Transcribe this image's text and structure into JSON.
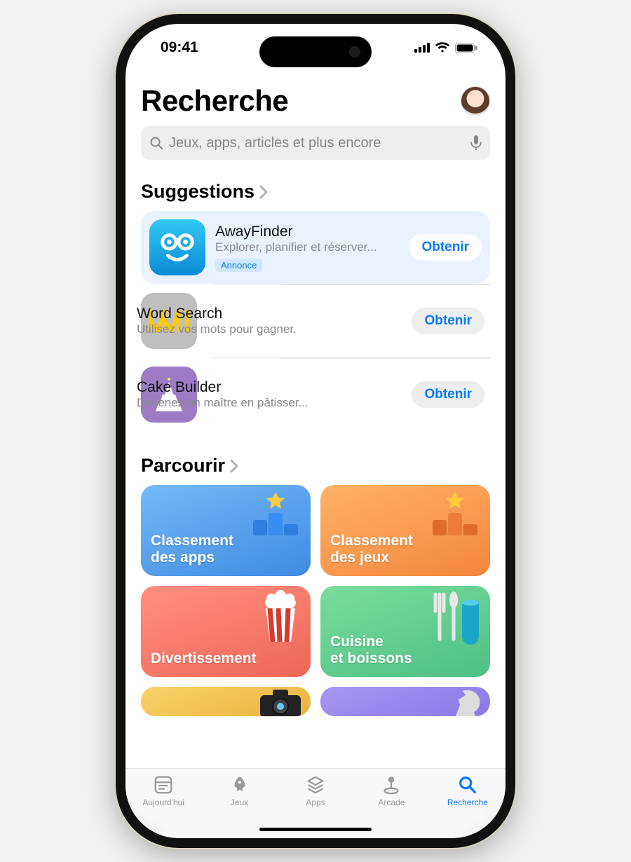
{
  "status": {
    "time": "09:41"
  },
  "header": {
    "title": "Recherche"
  },
  "search": {
    "placeholder": "Jeux, apps, articles et plus encore"
  },
  "sections": {
    "suggestions_title": "Suggestions",
    "browse_title": "Parcourir"
  },
  "suggestions": [
    {
      "name": "AwayFinder",
      "subtitle": "Explorer, planifier et réserver...",
      "badge": "Annonce",
      "action": "Obtenir",
      "promoted": true
    },
    {
      "name": "Word Search",
      "subtitle": "Utilisez vos mots pour gagner.",
      "action": "Obtenir"
    },
    {
      "name": "Cake Builder",
      "subtitle": "Devenez un maître en pâtisser...",
      "action": "Obtenir"
    }
  ],
  "browse": [
    {
      "label": "Classement des apps",
      "color": "c-blue"
    },
    {
      "label": "Classement des jeux",
      "color": "c-orange"
    },
    {
      "label": "Divertissement",
      "color": "c-red"
    },
    {
      "label": "Cuisine et boissons",
      "color": "c-green"
    }
  ],
  "tabs": [
    {
      "label": "Aujourd'hui",
      "icon": "today"
    },
    {
      "label": "Jeux",
      "icon": "games"
    },
    {
      "label": "Apps",
      "icon": "apps"
    },
    {
      "label": "Arcade",
      "icon": "arcade"
    },
    {
      "label": "Recherche",
      "icon": "search",
      "active": true
    }
  ]
}
